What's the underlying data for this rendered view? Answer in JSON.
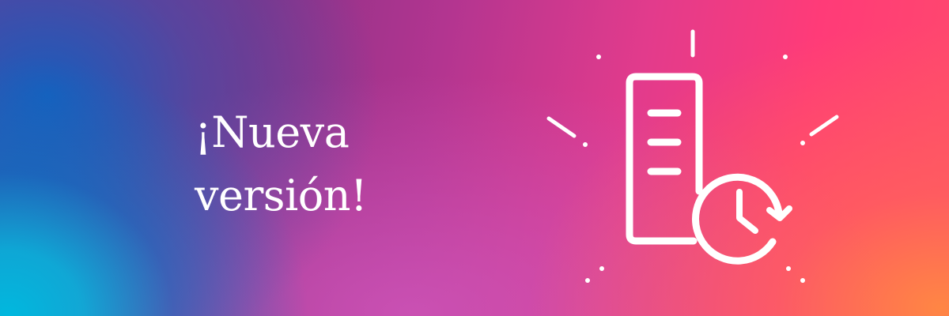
{
  "banner": {
    "headline_line1": "¡Nueva",
    "headline_line2": "versión!",
    "icon": "document-history-icon",
    "colors": {
      "blue": "#00b8de",
      "purple": "#8a3187",
      "magenta": "#e23b8c",
      "pink": "#ff3b78",
      "orange": "#ff8644",
      "foreground": "#ffffff"
    }
  }
}
